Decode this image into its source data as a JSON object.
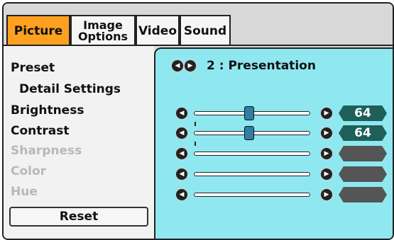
{
  "tabs": [
    {
      "line1": "Picture",
      "line2": "",
      "active": true
    },
    {
      "line1": "Image",
      "line2": "Options",
      "active": false
    },
    {
      "line1": "Video",
      "line2": "",
      "active": false
    },
    {
      "line1": "Sound",
      "line2": "",
      "active": false
    }
  ],
  "menu": {
    "preset": "Preset",
    "detail_settings": "Detail Settings",
    "brightness": "Brightness",
    "contrast": "Contrast",
    "sharpness": "Sharpness",
    "color": "Color",
    "hue": "Hue",
    "reset": "Reset"
  },
  "preset_value": "2 : Presentation",
  "sliders": [
    {
      "name": "brightness",
      "value": "64",
      "enabled": true
    },
    {
      "name": "contrast",
      "value": "64",
      "enabled": true
    },
    {
      "name": "sharpness",
      "value": "",
      "enabled": false
    },
    {
      "name": "color",
      "value": "",
      "enabled": false
    },
    {
      "name": "hue",
      "value": "",
      "enabled": false
    }
  ],
  "colors": {
    "active_tab": "#ffa020",
    "panel_bg": "#8fe8f0",
    "value_badge": "#1e5f5a",
    "slider_thumb": "#2f7ea8"
  },
  "icons": {
    "left_arrow": "left-arrow-icon",
    "right_arrow": "right-arrow-icon"
  }
}
